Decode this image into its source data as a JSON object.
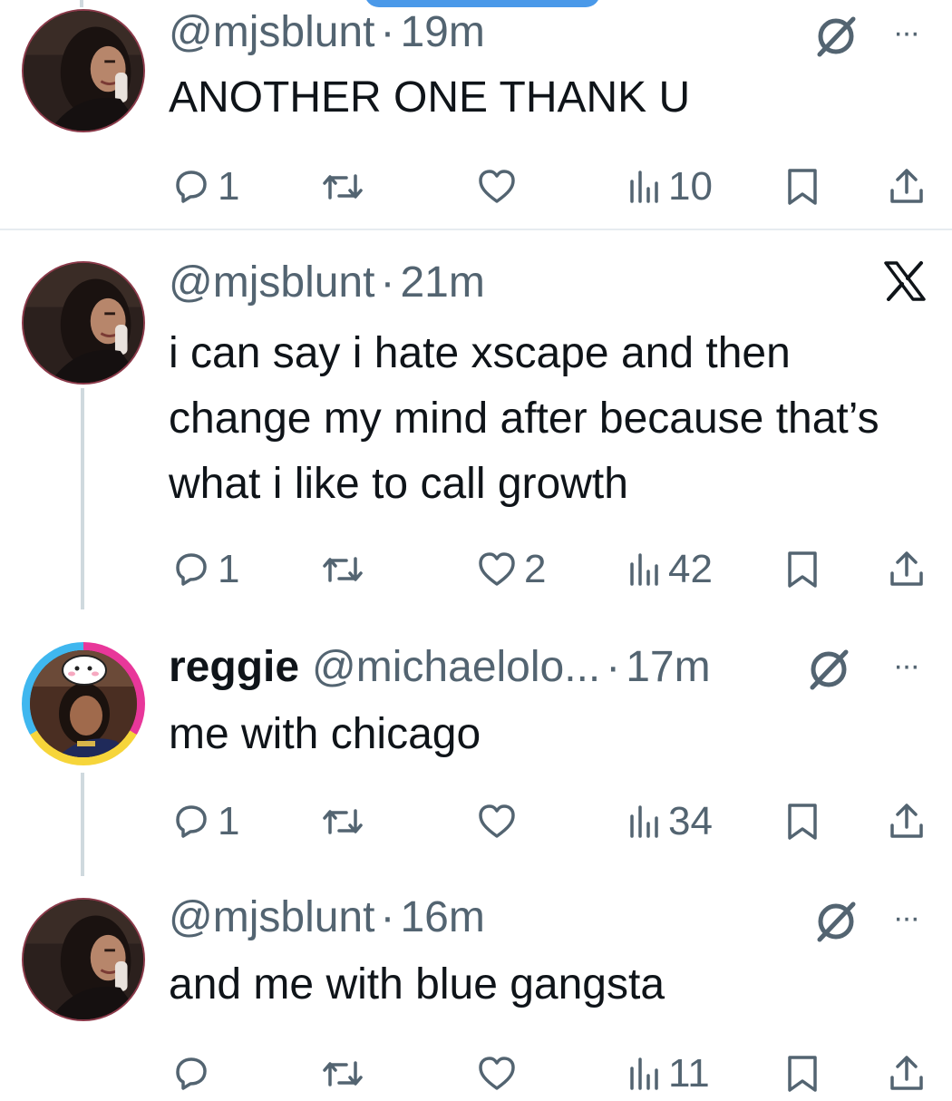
{
  "tweets": [
    {
      "display_name": "",
      "handle": "@mjsblunt",
      "time": "19m",
      "text": "ANOTHER ONE THANK U",
      "corner_icon": "grok-slash-icon",
      "stats": {
        "replies": "1",
        "reposts": "",
        "likes": "",
        "views": "10"
      }
    },
    {
      "display_name": "",
      "handle": "@mjsblunt",
      "time": "21m",
      "text": "i can say i hate xscape and then change my mind after because that’s what i like to call growth",
      "corner_icon": "x-logo-icon",
      "stats": {
        "replies": "1",
        "reposts": "",
        "likes": "2",
        "views": "42"
      }
    },
    {
      "display_name": "reggie",
      "handle": "@michaelolo...",
      "time": "17m",
      "text": "me with chicago",
      "corner_icon": "grok-slash-icon",
      "stats": {
        "replies": "1",
        "reposts": "",
        "likes": "",
        "views": "34"
      }
    },
    {
      "display_name": "",
      "handle": "@mjsblunt",
      "time": "16m",
      "text": "and me with blue gangsta",
      "corner_icon": "grok-slash-icon",
      "stats": {
        "replies": "",
        "reposts": "",
        "likes": "",
        "views": "11"
      }
    }
  ],
  "more_glyph": "···",
  "separator": "·",
  "colors": {
    "text_primary": "#0f1419",
    "text_secondary": "#536471",
    "thread_line": "#cfd9de",
    "divider": "#e6ecf0",
    "accent_pill": "#4a99e9"
  }
}
